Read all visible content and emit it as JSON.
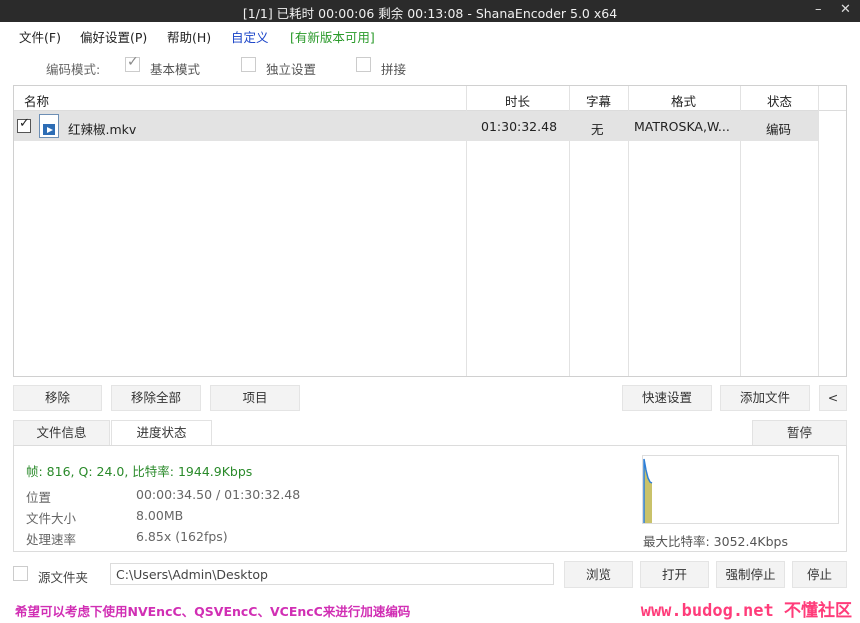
{
  "window": {
    "title": "[1/1] 已耗时 00:00:06  剩余 00:13:08 - ShanaEncoder 5.0 x64",
    "minimize": "–",
    "close": "✕"
  },
  "menu": {
    "file": "文件(F)",
    "prefs": "偏好设置(P)",
    "help": "帮助(H)",
    "custom": "自定义",
    "update": "[有新版本可用]"
  },
  "mode": {
    "label": "编码模式:",
    "basic": "基本模式",
    "independent": "独立设置",
    "concat": "拼接"
  },
  "filelist": {
    "columns": [
      "名称",
      "时长",
      "字幕",
      "格式",
      "状态"
    ],
    "rows": [
      {
        "checked": true,
        "name": "红辣椒.mkv",
        "duration": "01:30:32.48",
        "subtitle": "无",
        "format": "MATROSKA,W...",
        "status": "编码"
      }
    ]
  },
  "actions": {
    "remove": "移除",
    "remove_all": "移除全部",
    "item": "项目",
    "quick_settings": "快速设置",
    "add_file": "添加文件",
    "collapse": "<"
  },
  "tabs": {
    "file_info": "文件信息",
    "progress": "进度状态",
    "pause": "暂停"
  },
  "progress": {
    "stats": "帧: 816, Q: 24.0, 比特率: 1944.9Kbps",
    "position_label": "位置",
    "position_value": "00:00:34.50 / 01:30:32.48",
    "filesize_label": "文件大小",
    "filesize_value": "8.00MB",
    "speed_label": "处理速率",
    "speed_value": "6.85x (162fps)",
    "max_bitrate": "最大比特率: 3052.4Kbps",
    "graph_colors": {
      "bar": "#2f7fd6",
      "fill": "#c9c26a"
    }
  },
  "bottom": {
    "source_folder_label": "源文件夹",
    "path": "C:\\Users\\Admin\\Desktop",
    "browse": "浏览",
    "open": "打开",
    "force_stop": "强制停止",
    "stop": "停止"
  },
  "status": {
    "tip": "希望可以考虑下使用NVEncC、QSVEncC、VCEncC来进行加速编码",
    "watermark": "www.budog.net 不懂社区"
  }
}
